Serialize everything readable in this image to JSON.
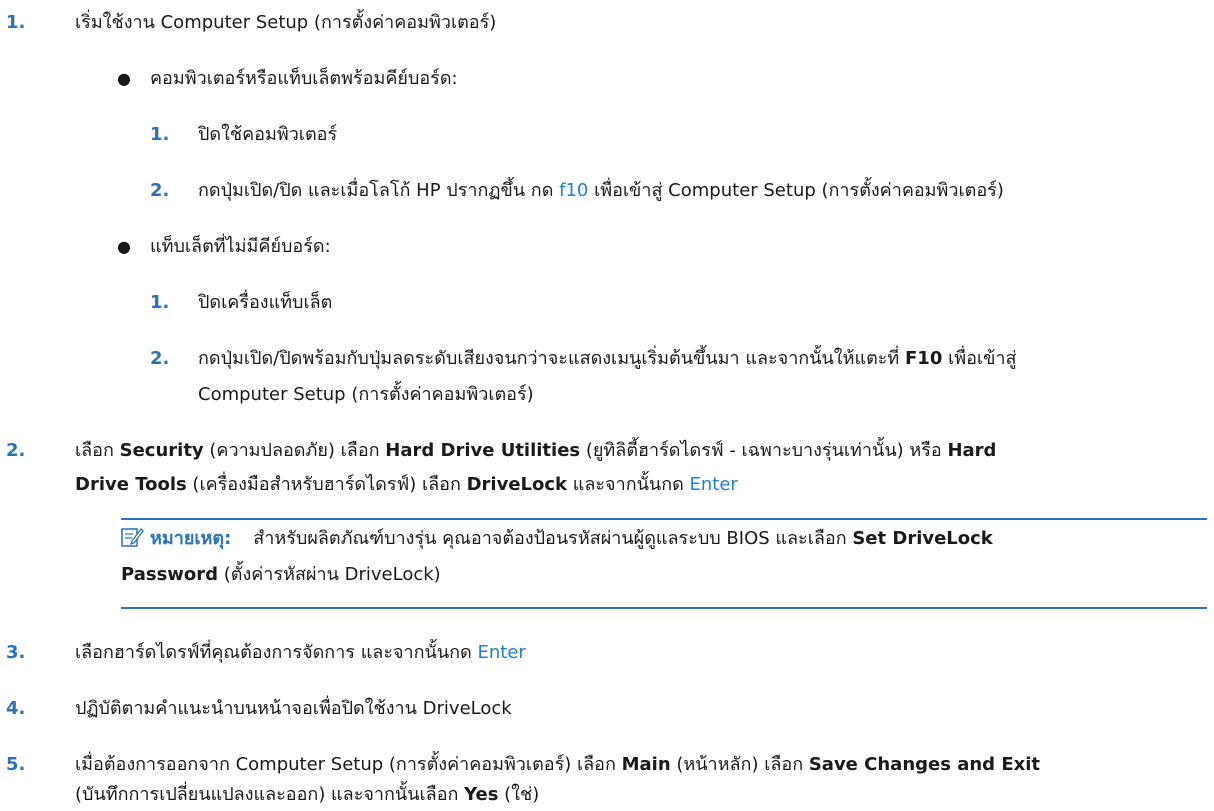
{
  "steps": [
    {
      "num": "1.",
      "text": "เริ่มใช้งาน Computer Setup (การตั้งค่าคอมพิวเตอร์)"
    },
    {
      "num": "2.",
      "parts": [
        "เลือก ",
        "Security",
        " (ความปลอดภัย) เลือก ",
        "Hard Drive Utilities",
        " (ยูทิลิตี้ฮาร์ดไดรฟ์ - เฉพาะบางรุ่นเท่านั้น) หรือ ",
        "Hard",
        "Drive Tools",
        " (เครื่องมือสำหรับฮาร์ดไดรฟ์) เลือก ",
        "DriveLock",
        " และจากนั้นกด ",
        "Enter"
      ]
    },
    {
      "num": "3.",
      "text": "เลือกฮาร์ดไดรฟ์ที่คุณต้องการจัดการ และจากนั้นกด ",
      "key": "Enter"
    },
    {
      "num": "4.",
      "text": "ปฏิบัติตามคำแนะนำบนหน้าจอเพื่อปิดใช้งาน DriveLock"
    },
    {
      "num": "5.",
      "parts": [
        "เมื่อต้องการออกจาก Computer Setup (การตั้งค่าคอมพิวเตอร์) เลือก ",
        "Main",
        " (หน้าหลัก) เลือก ",
        "Save Changes and Exit",
        "(บันทึกการเปลี่ยนแปลงและออก) และจากนั้นเลือก ",
        "Yes",
        " (ใช่)"
      ]
    }
  ],
  "bullets": [
    {
      "text": "คอมพิวเตอร์หรือแท็บเล็ตพร้อมคีย์บอร์ด:",
      "substeps": [
        {
          "num": "1.",
          "text": "ปิดใช้คอมพิวเตอร์"
        },
        {
          "num": "2.",
          "pre": "กดปุ่มเปิด/ปิด และเมื่อโลโก้ HP ปรากฏขึ้น กด ",
          "key": "f10",
          "post": " เพื่อเข้าสู่ Computer Setup (การตั้งค่าคอมพิวเตอร์)"
        }
      ]
    },
    {
      "text": "แท็บเล็ตที่ไม่มีคีย์บอร์ด:",
      "substeps": [
        {
          "num": "1.",
          "text": "ปิดเครื่องแท็บเล็ต"
        },
        {
          "num": "2.",
          "pre": "กดปุ่มเปิด/ปิดพร้อมกับปุ่มลดระดับเสียงจนกว่าจะแสดงเมนูเริ่มต้นขึ้นมา และจากนั้นให้แตะที่ ",
          "key": "F10",
          "post": " เพื่อเข้าสู่",
          "line2": "Computer Setup (การตั้งค่าคอมพิวเตอร์)"
        }
      ]
    }
  ],
  "note": {
    "label": "หมายเหตุ:",
    "text": "สำหรับผลิตภัณฑ์บางรุ่น คุณอาจต้องป้อนรหัสผ่านผู้ดูแลระบบ BIOS และเลือก ",
    "bold1": "Set DriveLock",
    "bold2": "Password",
    "text2": " (ตั้งค่ารหัสผ่าน DriveLock)",
    "icon": "note-pencil-icon",
    "accent": "#2a73b8"
  },
  "colors": {
    "number": "#2a73b8",
    "key": "#1d7fd8",
    "text": "#1a1a1a"
  }
}
